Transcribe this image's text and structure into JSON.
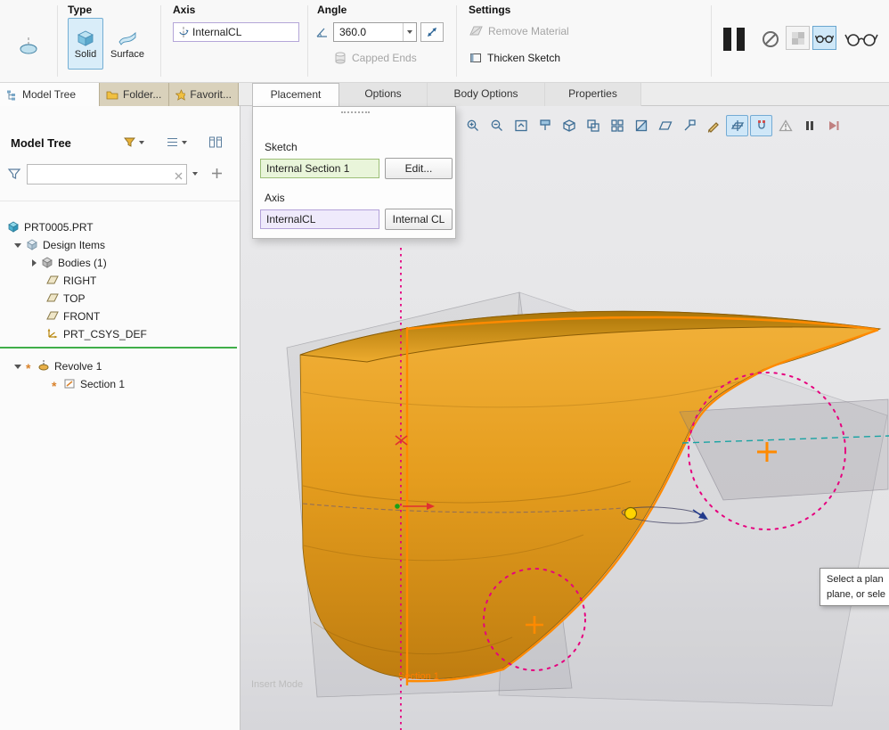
{
  "ribbon": {
    "type_group": {
      "label": "Type",
      "solid_button": "Solid",
      "surface_button": "Surface"
    },
    "axis_group": {
      "label": "Axis",
      "axis_collector": "InternalCL"
    },
    "angle_group": {
      "label": "Angle",
      "angle_value": "360.0",
      "capped_ends_label": "Capped Ends"
    },
    "settings_group": {
      "label": "Settings",
      "remove_material_label": "Remove Material",
      "thicken_sketch_label": "Thicken Sketch"
    },
    "right_icons": [
      "pause-icon",
      "no-preview-icon",
      "unattached-preview-icon",
      "attached-preview-icon",
      "verify-glasses-icon"
    ]
  },
  "dashboard_tabs": {
    "placement": "Placement",
    "options": "Options",
    "body_options": "Body Options",
    "properties": "Properties"
  },
  "placement_panel": {
    "sketch_label": "Sketch",
    "sketch_collector": "Internal Section 1",
    "edit_button": "Edit...",
    "axis_label": "Axis",
    "axis_collector": "InternalCL",
    "internal_cl_button": "Internal CL"
  },
  "left_panel": {
    "tabs": {
      "model_tree": "Model Tree",
      "folder_browser": "Folder...",
      "favorites": "Favorit..."
    },
    "header_title": "Model Tree",
    "search_value": "",
    "tree": [
      {
        "label": "PRT0005.PRT",
        "icon": "part-icon"
      },
      {
        "label": "Design Items",
        "icon": "design-items-icon"
      },
      {
        "label": "Bodies (1)",
        "icon": "bodies-icon"
      },
      {
        "label": "RIGHT",
        "icon": "datum-plane-icon"
      },
      {
        "label": "TOP",
        "icon": "datum-plane-icon"
      },
      {
        "label": "FRONT",
        "icon": "datum-plane-icon"
      },
      {
        "label": "PRT_CSYS_DEF",
        "icon": "csys-icon"
      },
      {
        "label": "Revolve 1",
        "icon": "revolve-feature-icon",
        "badge": "pending-asterisk"
      },
      {
        "label": "Section 1",
        "icon": "sketch-icon",
        "badge": "pending-asterisk"
      }
    ]
  },
  "graphics_toolbar": {
    "icons": [
      "zoom-in",
      "zoom-out",
      "refit",
      "repaint",
      "display-style",
      "saved-orientations",
      "view-manager",
      "section",
      "datum-display",
      "annotation-display",
      "sketch-display",
      "dragger-display",
      "snap-mode",
      "warnings",
      "pause",
      "resume"
    ]
  },
  "canvas": {
    "section_tag": "Section 1",
    "insert_mode_watermark": "Insert Mode",
    "tooltip_line1": "Select a plan",
    "tooltip_line2": "plane, or sele"
  },
  "colors": {
    "model_fill": "#e49a1d",
    "highlight_orange": "#ff8a00",
    "axis_magenta": "#e6007e",
    "teal_dash": "#18a3a3",
    "active_blue_bg": "#cfe7f8",
    "insert_line_green": "#3fae49",
    "sketch_field_green": "#e9f5da",
    "axis_field_purple": "#efeafb"
  }
}
